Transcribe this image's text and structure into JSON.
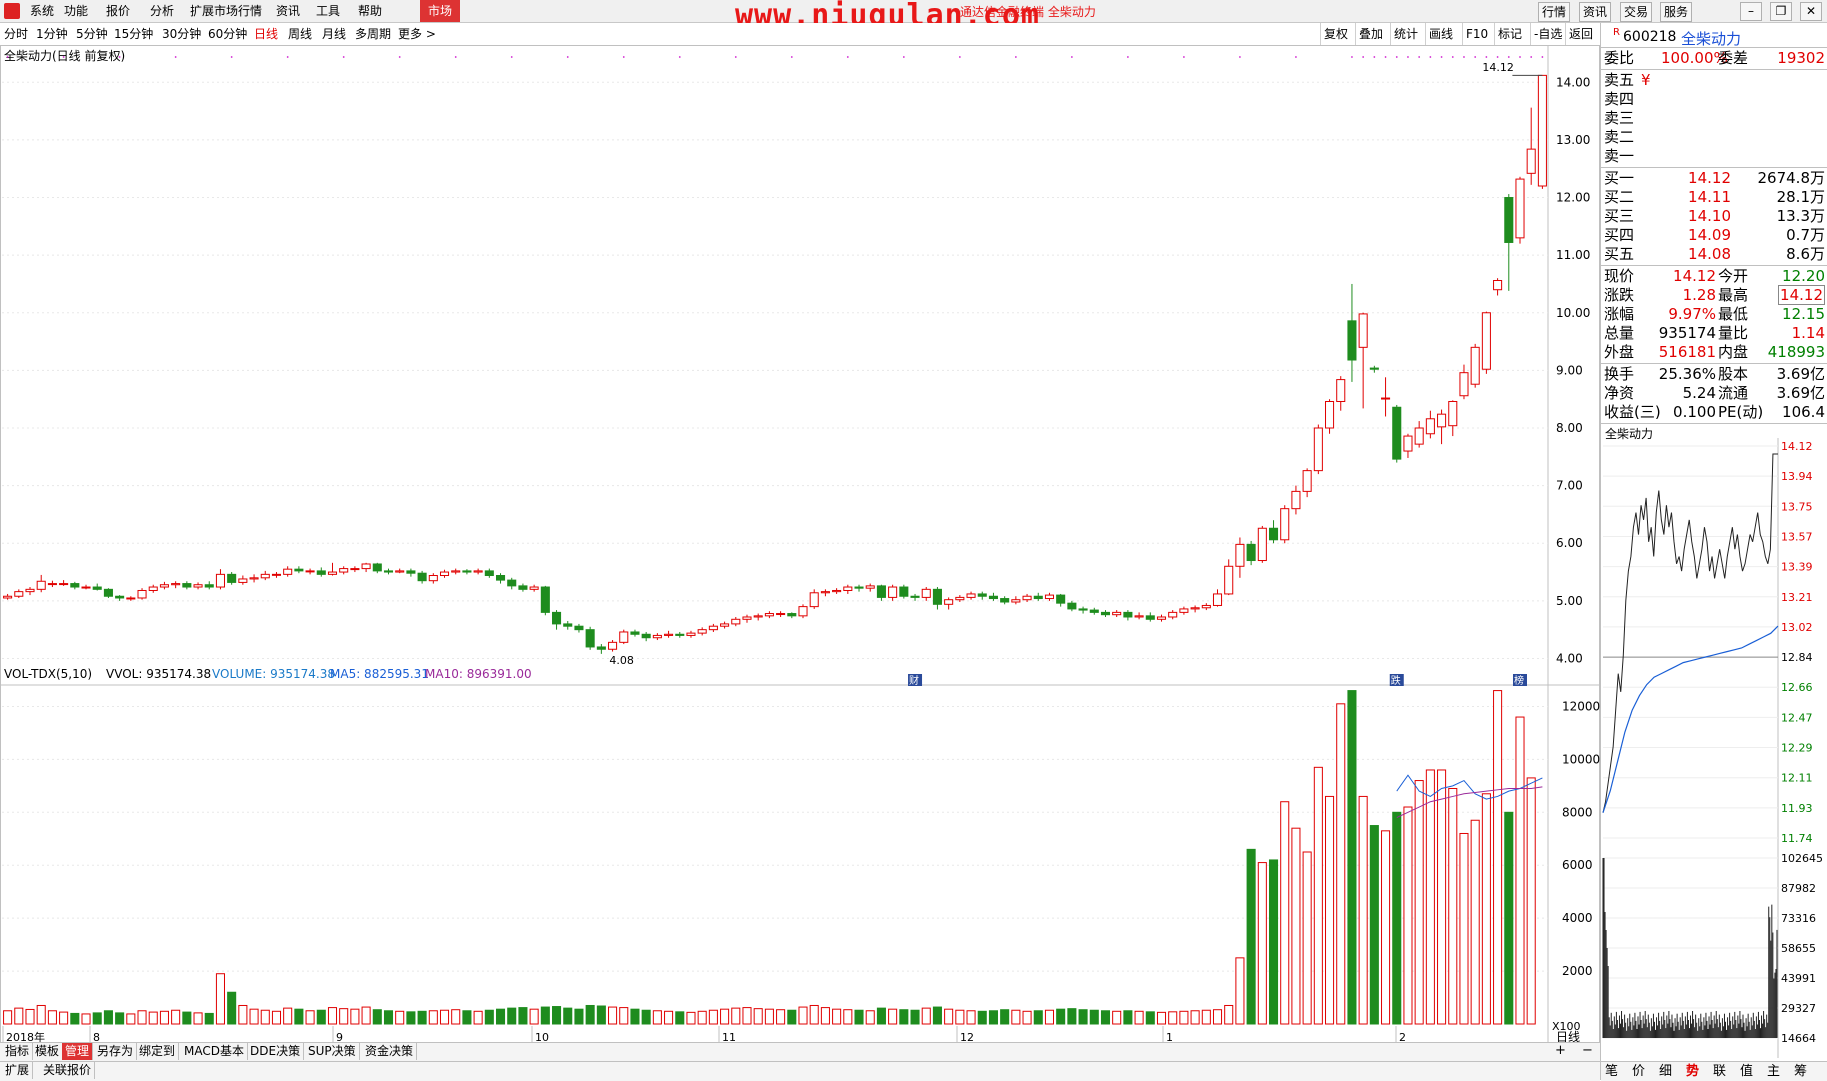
{
  "menu": {
    "items": [
      "系统",
      "功能",
      "报价",
      "分析",
      "扩展市场行情",
      "资讯",
      "工具",
      "帮助"
    ],
    "market_tab": "市场",
    "watermark": "www.niugulan.com",
    "watermark_sub": "通达信金融终端 全柴动力",
    "right_buttons": [
      "行情",
      "资讯",
      "交易",
      "服务"
    ]
  },
  "periods": {
    "items": [
      "分时",
      "1分钟",
      "5分钟",
      "15分钟",
      "30分钟",
      "60分钟",
      "日线",
      "周线",
      "月线",
      "多周期",
      "更多 >"
    ],
    "active": "日线"
  },
  "toolbar": [
    "复权",
    "叠加",
    "统计",
    "画线",
    "F10",
    "标记",
    "-自选",
    "返回"
  ],
  "chart": {
    "title": "全柴动力(日线 前复权)",
    "price_ticks": [
      "14.00",
      "13.00",
      "12.00",
      "11.00",
      "10.00",
      "9.00",
      "8.00",
      "7.00",
      "6.00",
      "5.00",
      "4.00"
    ],
    "max_label": "14.12",
    "min_label": "4.08",
    "markers": [
      "财",
      "跌",
      "榜"
    ],
    "vol_header": {
      "name": "VOL-TDX(5,10)",
      "vvol": "VVOL: 935174.38",
      "volume": "VOLUME: 935174.38",
      "ma5": "MA5: 882595.31",
      "ma10": "MA10: 896391.00"
    },
    "vol_ticks": [
      "12000",
      "10000",
      "8000",
      "6000",
      "4000",
      "2000"
    ],
    "vol_unit": "X100",
    "dates": [
      "2018年",
      "8",
      "9",
      "10",
      "11",
      "12",
      "1",
      "2"
    ],
    "date_period": "日线"
  },
  "chart_data": {
    "type": "candlestick",
    "ylim": [
      3.8,
      14.3
    ],
    "vol_ylim": [
      0,
      13000
    ],
    "candles": [
      [
        5.05,
        5.08,
        5.12,
        5.02
      ],
      [
        5.08,
        5.16,
        5.2,
        5.05
      ],
      [
        5.16,
        5.2,
        5.24,
        5.1
      ],
      [
        5.2,
        5.34,
        5.45,
        5.15
      ],
      [
        5.3,
        5.3,
        5.35,
        5.24
      ],
      [
        5.3,
        5.3,
        5.36,
        5.26
      ],
      [
        5.3,
        5.24,
        5.33,
        5.2
      ],
      [
        5.24,
        5.24,
        5.28,
        5.2
      ],
      [
        5.24,
        5.2,
        5.3,
        5.18
      ],
      [
        5.2,
        5.08,
        5.22,
        5.05
      ],
      [
        5.08,
        5.05,
        5.1,
        5.0
      ],
      [
        5.05,
        5.05,
        5.08,
        5.0
      ],
      [
        5.05,
        5.18,
        5.22,
        5.02
      ],
      [
        5.18,
        5.24,
        5.28,
        5.14
      ],
      [
        5.24,
        5.28,
        5.33,
        5.2
      ],
      [
        5.28,
        5.3,
        5.34,
        5.22
      ],
      [
        5.3,
        5.24,
        5.34,
        5.2
      ],
      [
        5.24,
        5.28,
        5.32,
        5.2
      ],
      [
        5.28,
        5.24,
        5.34,
        5.2
      ],
      [
        5.24,
        5.46,
        5.55,
        5.2
      ],
      [
        5.46,
        5.32,
        5.5,
        5.28
      ],
      [
        5.32,
        5.38,
        5.44,
        5.28
      ],
      [
        5.38,
        5.4,
        5.46,
        5.32
      ],
      [
        5.4,
        5.46,
        5.52,
        5.36
      ],
      [
        5.46,
        5.46,
        5.5,
        5.4
      ],
      [
        5.46,
        5.55,
        5.6,
        5.42
      ],
      [
        5.55,
        5.52,
        5.6,
        5.48
      ],
      [
        5.52,
        5.52,
        5.56,
        5.46
      ],
      [
        5.52,
        5.46,
        5.58,
        5.42
      ],
      [
        5.46,
        5.5,
        5.66,
        5.44
      ],
      [
        5.5,
        5.56,
        5.6,
        5.46
      ],
      [
        5.56,
        5.56,
        5.6,
        5.5
      ],
      [
        5.56,
        5.64,
        5.66,
        5.5
      ],
      [
        5.64,
        5.52,
        5.66,
        5.48
      ],
      [
        5.52,
        5.5,
        5.56,
        5.46
      ],
      [
        5.5,
        5.52,
        5.56,
        5.48
      ],
      [
        5.52,
        5.48,
        5.56,
        5.42
      ],
      [
        5.48,
        5.35,
        5.52,
        5.3
      ],
      [
        5.35,
        5.44,
        5.48,
        5.3
      ],
      [
        5.44,
        5.5,
        5.54,
        5.4
      ],
      [
        5.5,
        5.52,
        5.56,
        5.46
      ],
      [
        5.52,
        5.5,
        5.55,
        5.46
      ],
      [
        5.5,
        5.52,
        5.56,
        5.46
      ],
      [
        5.52,
        5.44,
        5.56,
        5.4
      ],
      [
        5.44,
        5.36,
        5.48,
        5.3
      ],
      [
        5.36,
        5.26,
        5.4,
        5.2
      ],
      [
        5.26,
        5.2,
        5.3,
        5.16
      ],
      [
        5.2,
        5.24,
        5.28,
        5.16
      ],
      [
        5.24,
        4.8,
        5.26,
        4.75
      ],
      [
        4.8,
        4.6,
        4.84,
        4.5
      ],
      [
        4.6,
        4.56,
        4.65,
        4.5
      ],
      [
        4.56,
        4.5,
        4.6,
        4.45
      ],
      [
        4.5,
        4.2,
        4.55,
        4.15
      ],
      [
        4.2,
        4.16,
        4.25,
        4.08
      ],
      [
        4.16,
        4.28,
        4.32,
        4.12
      ],
      [
        4.28,
        4.46,
        4.5,
        4.25
      ],
      [
        4.46,
        4.42,
        4.5,
        4.38
      ],
      [
        4.42,
        4.36,
        4.46,
        4.3
      ],
      [
        4.36,
        4.4,
        4.44,
        4.32
      ],
      [
        4.4,
        4.42,
        4.48,
        4.36
      ],
      [
        4.42,
        4.4,
        4.46,
        4.36
      ],
      [
        4.4,
        4.44,
        4.48,
        4.36
      ],
      [
        4.44,
        4.5,
        4.54,
        4.4
      ],
      [
        4.5,
        4.56,
        4.6,
        4.46
      ],
      [
        4.56,
        4.6,
        4.64,
        4.52
      ],
      [
        4.6,
        4.68,
        4.72,
        4.56
      ],
      [
        4.68,
        4.72,
        4.76,
        4.62
      ],
      [
        4.72,
        4.74,
        4.78,
        4.66
      ],
      [
        4.74,
        4.78,
        4.82,
        4.7
      ],
      [
        4.78,
        4.78,
        4.82,
        4.72
      ],
      [
        4.78,
        4.74,
        4.8,
        4.7
      ],
      [
        4.74,
        4.9,
        4.94,
        4.7
      ],
      [
        4.9,
        5.14,
        5.2,
        4.86
      ],
      [
        5.14,
        5.16,
        5.2,
        5.08
      ],
      [
        5.16,
        5.18,
        5.22,
        5.12
      ],
      [
        5.18,
        5.24,
        5.28,
        5.12
      ],
      [
        5.24,
        5.22,
        5.28,
        5.16
      ],
      [
        5.22,
        5.26,
        5.3,
        5.16
      ],
      [
        5.26,
        5.06,
        5.28,
        5.0
      ],
      [
        5.06,
        5.24,
        5.28,
        5.0
      ],
      [
        5.24,
        5.08,
        5.28,
        5.04
      ],
      [
        5.08,
        5.06,
        5.12,
        5.0
      ],
      [
        5.06,
        5.2,
        5.24,
        5.0
      ],
      [
        5.2,
        4.94,
        5.24,
        4.85
      ],
      [
        4.94,
        5.02,
        5.06,
        4.85
      ],
      [
        5.02,
        5.06,
        5.1,
        4.98
      ],
      [
        5.06,
        5.12,
        5.16,
        5.02
      ],
      [
        5.12,
        5.08,
        5.16,
        5.02
      ],
      [
        5.08,
        5.04,
        5.14,
        5.0
      ],
      [
        5.04,
        4.98,
        5.08,
        4.94
      ],
      [
        4.98,
        5.02,
        5.08,
        4.94
      ],
      [
        5.02,
        5.08,
        5.12,
        4.98
      ],
      [
        5.08,
        5.04,
        5.14,
        5.0
      ],
      [
        5.04,
        5.1,
        5.14,
        5.0
      ],
      [
        5.1,
        4.96,
        5.12,
        4.9
      ],
      [
        4.96,
        4.86,
        5.0,
        4.82
      ],
      [
        4.86,
        4.84,
        4.9,
        4.78
      ],
      [
        4.84,
        4.8,
        4.88,
        4.76
      ],
      [
        4.8,
        4.76,
        4.84,
        4.72
      ],
      [
        4.76,
        4.8,
        4.84,
        4.72
      ],
      [
        4.8,
        4.72,
        4.84,
        4.66
      ],
      [
        4.72,
        4.74,
        4.8,
        4.68
      ],
      [
        4.74,
        4.68,
        4.8,
        4.64
      ],
      [
        4.68,
        4.72,
        4.76,
        4.64
      ],
      [
        4.72,
        4.8,
        4.84,
        4.68
      ],
      [
        4.8,
        4.86,
        4.9,
        4.76
      ],
      [
        4.86,
        4.88,
        4.92,
        4.8
      ],
      [
        4.88,
        4.92,
        4.96,
        4.84
      ],
      [
        4.92,
        5.12,
        5.2,
        4.9
      ],
      [
        5.12,
        5.6,
        5.72,
        5.1
      ],
      [
        5.6,
        5.98,
        6.1,
        5.4
      ],
      [
        5.98,
        5.7,
        6.04,
        5.62
      ],
      [
        5.7,
        6.26,
        6.3,
        5.66
      ],
      [
        6.26,
        6.06,
        6.4,
        6.0
      ],
      [
        6.06,
        6.6,
        6.66,
        6.0
      ],
      [
        6.6,
        6.9,
        7.0,
        6.5
      ],
      [
        6.9,
        7.26,
        7.3,
        6.8
      ],
      [
        7.26,
        8.0,
        8.06,
        7.2
      ],
      [
        8.0,
        8.46,
        8.5,
        7.9
      ],
      [
        8.46,
        8.84,
        8.9,
        8.3
      ],
      [
        9.86,
        9.18,
        10.5,
        8.8
      ],
      [
        9.4,
        9.98,
        10.0,
        8.34
      ],
      [
        9.04,
        9.02,
        9.08,
        8.96
      ],
      [
        8.52,
        8.52,
        8.88,
        8.2
      ],
      [
        8.36,
        7.46,
        8.4,
        7.4
      ],
      [
        7.6,
        7.86,
        7.9,
        7.48
      ],
      [
        7.72,
        8.0,
        8.12,
        7.66
      ],
      [
        7.9,
        8.16,
        8.3,
        7.82
      ],
      [
        8.02,
        8.24,
        8.32,
        7.72
      ],
      [
        8.04,
        8.46,
        8.48,
        7.86
      ],
      [
        8.56,
        8.96,
        9.1,
        8.5
      ],
      [
        8.76,
        9.4,
        9.46,
        8.7
      ],
      [
        9.02,
        10.0,
        10.02,
        8.94
      ],
      [
        10.4,
        10.56,
        10.6,
        10.3
      ],
      [
        12.0,
        11.22,
        12.06,
        10.38
      ],
      [
        11.3,
        12.32,
        12.36,
        11.2
      ],
      [
        12.42,
        12.84,
        13.56,
        12.22
      ],
      [
        12.2,
        14.12,
        14.12,
        12.15
      ]
    ],
    "volumes": [
      500,
      600,
      550,
      700,
      500,
      450,
      400,
      380,
      420,
      500,
      420,
      380,
      500,
      450,
      480,
      520,
      450,
      420,
      400,
      1900,
      1200,
      700,
      560,
      520,
      480,
      600,
      560,
      500,
      520,
      620,
      580,
      560,
      640,
      540,
      500,
      480,
      460,
      480,
      500,
      520,
      540,
      500,
      480,
      520,
      560,
      600,
      620,
      560,
      640,
      660,
      600,
      560,
      700,
      680,
      640,
      620,
      560,
      520,
      500,
      480,
      460,
      440,
      480,
      520,
      560,
      600,
      620,
      580,
      560,
      540,
      520,
      640,
      700,
      620,
      560,
      540,
      520,
      500,
      600,
      560,
      540,
      520,
      600,
      640,
      560,
      520,
      500,
      480,
      500,
      540,
      520,
      480,
      500,
      520,
      560,
      580,
      540,
      520,
      500,
      480,
      500,
      480,
      460,
      440,
      460,
      480,
      500,
      520,
      540,
      700,
      2500,
      6600,
      6100,
      6200,
      8400,
      7400,
      6500,
      9700,
      8600,
      12100,
      12600,
      8600,
      7500,
      7300,
      8000,
      8200,
      9200,
      9600,
      9600,
      8900,
      7200,
      7700,
      8700,
      12600,
      8000,
      11600,
      9300
    ],
    "ma5": [
      8800,
      9400,
      8800,
      8600,
      8900,
      9000,
      9200,
      8700,
      8500,
      8600,
      8800,
      8900,
      9100,
      9300
    ],
    "ma10": [
      7800,
      8000,
      8200,
      8400,
      8500,
      8600,
      8700,
      8750,
      8800,
      8850,
      8900,
      8900,
      8900,
      8963
    ]
  },
  "quote": {
    "code": "600218",
    "name": "全柴动力",
    "r_flag": "R",
    "weibi_label": "委比",
    "weibi": "100.00%",
    "weicha_label": "委差",
    "weicha": "19302",
    "sells": [
      {
        "label": "卖五",
        "price": "",
        "vol": "¥"
      },
      {
        "label": "卖四",
        "price": "",
        "vol": ""
      },
      {
        "label": "卖三",
        "price": "",
        "vol": ""
      },
      {
        "label": "卖二",
        "price": "",
        "vol": ""
      },
      {
        "label": "卖一",
        "price": "",
        "vol": ""
      }
    ],
    "buys": [
      {
        "label": "买一",
        "price": "14.12",
        "vol": "2674.8万"
      },
      {
        "label": "买二",
        "price": "14.11",
        "vol": "28.1万"
      },
      {
        "label": "买三",
        "price": "14.10",
        "vol": "13.3万"
      },
      {
        "label": "买四",
        "price": "14.09",
        "vol": "0.7万"
      },
      {
        "label": "买五",
        "price": "14.08",
        "vol": "8.6万"
      }
    ],
    "stats": [
      {
        "l1": "现价",
        "v1": "14.12",
        "l2": "今开",
        "v2": "12.20",
        "c1": "red",
        "c2": "green"
      },
      {
        "l1": "涨跌",
        "v1": "1.28",
        "l2": "最高",
        "v2": "14.12",
        "c1": "red",
        "c2": "red"
      },
      {
        "l1": "涨幅",
        "v1": "9.97%",
        "l2": "最低",
        "v2": "12.15",
        "c1": "red",
        "c2": "green"
      },
      {
        "l1": "总量",
        "v1": "935174",
        "l2": "量比",
        "v2": "1.14",
        "c1": "black",
        "c2": "red"
      },
      {
        "l1": "外盘",
        "v1": "516181",
        "l2": "内盘",
        "v2": "418993",
        "c1": "red",
        "c2": "green"
      },
      {
        "l1": "换手",
        "v1": "25.36%",
        "l2": "股本",
        "v2": "3.69亿",
        "c1": "black",
        "c2": "black"
      },
      {
        "l1": "净资",
        "v1": "5.24",
        "l2": "流通",
        "v2": "3.69亿",
        "c1": "black",
        "c2": "black"
      },
      {
        "l1": "收益(三)",
        "v1": "0.100",
        "l2": "PE(动)",
        "v2": "106.4",
        "c1": "black",
        "c2": "black"
      }
    ],
    "mini_title": "全柴动力",
    "mini_price_ticks": [
      "14.12",
      "13.94",
      "13.75",
      "13.57",
      "13.39",
      "13.21",
      "13.02",
      "12.84",
      "12.66",
      "12.47",
      "12.29",
      "12.11",
      "11.93",
      "11.74"
    ],
    "mini_vol_ticks": [
      "102645",
      "87982",
      "73316",
      "58655",
      "43991",
      "29327",
      "14664"
    ],
    "bottom_tabs": [
      "笔",
      "价",
      "细",
      "势",
      "联",
      "值",
      "主",
      "筹"
    ],
    "bottom_active": "势"
  },
  "bottom": {
    "tabs": [
      "指标",
      "模板",
      "管理",
      "另存为",
      "绑定到",
      "MACD基本",
      "DDE决策",
      "SUP决策",
      "资金决策"
    ],
    "active": "管理",
    "status": [
      "扩展",
      "关联报价"
    ]
  },
  "colors": {
    "up": "#e00000",
    "down": "#1e8c1e",
    "ma5": "#1a5fd6",
    "ma10": "#9a2a9a",
    "grid": "#e8e8e8"
  }
}
